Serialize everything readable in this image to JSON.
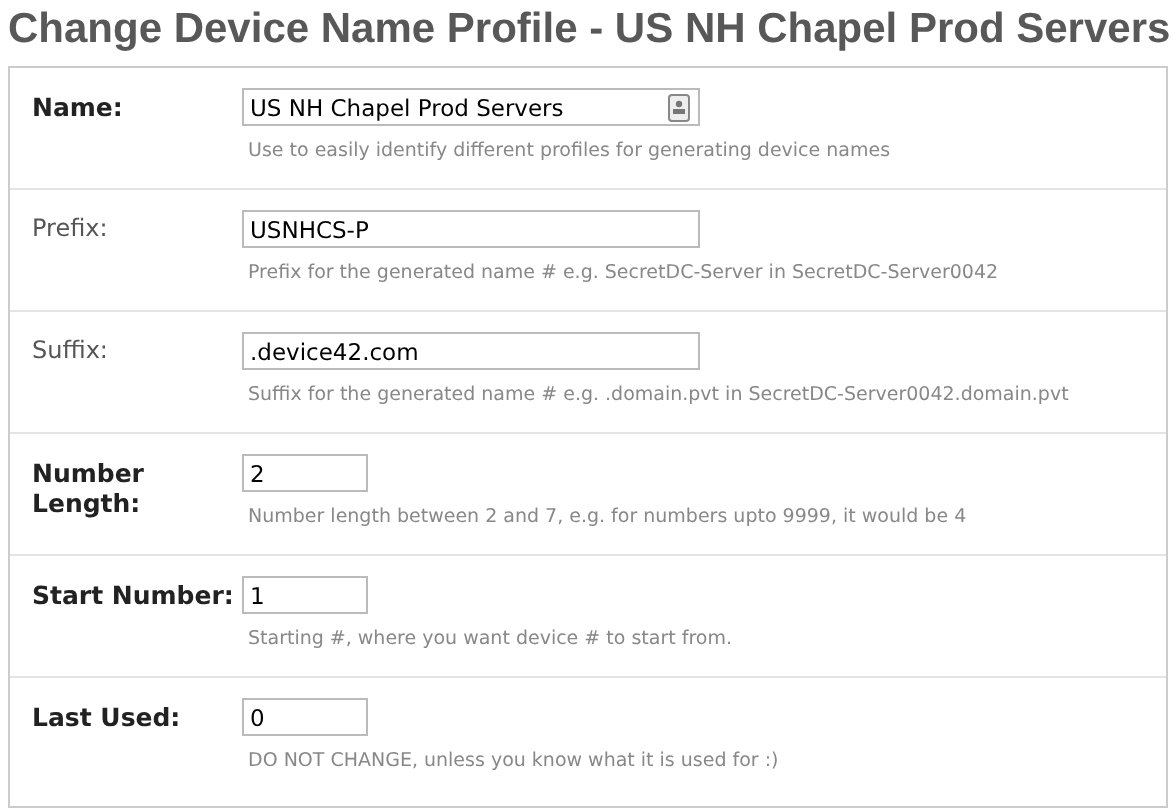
{
  "title": "Change Device Name Profile - US NH Chapel Prod Servers",
  "fields": [
    {
      "label": "Name:",
      "required": true,
      "kind": "wide-icon",
      "value": "US NH Chapel Prod Servers",
      "hint": "Use to easily identify different profiles for generating device names"
    },
    {
      "label": "Prefix:",
      "required": false,
      "kind": "wide",
      "value": "USNHCS-P",
      "hint": "Prefix for the generated name # e.g. SecretDC-Server in SecretDC-Server0042"
    },
    {
      "label": "Suffix:",
      "required": false,
      "kind": "wide",
      "value": ".device42.com",
      "hint": "Suffix for the generated name # e.g. .domain.pvt in SecretDC-Server0042.domain.pvt"
    },
    {
      "label": "Number Length:",
      "required": true,
      "kind": "short",
      "value": "2",
      "hint": "Number length between 2 and 7, e.g. for numbers upto 9999, it would be 4"
    },
    {
      "label": "Start Number:",
      "required": true,
      "kind": "short",
      "value": "1",
      "hint": "Starting #, where you want device # to start from."
    },
    {
      "label": "Last Used:",
      "required": true,
      "kind": "short",
      "value": "0",
      "hint": "DO NOT CHANGE, unless you know what it is used for :)"
    }
  ]
}
